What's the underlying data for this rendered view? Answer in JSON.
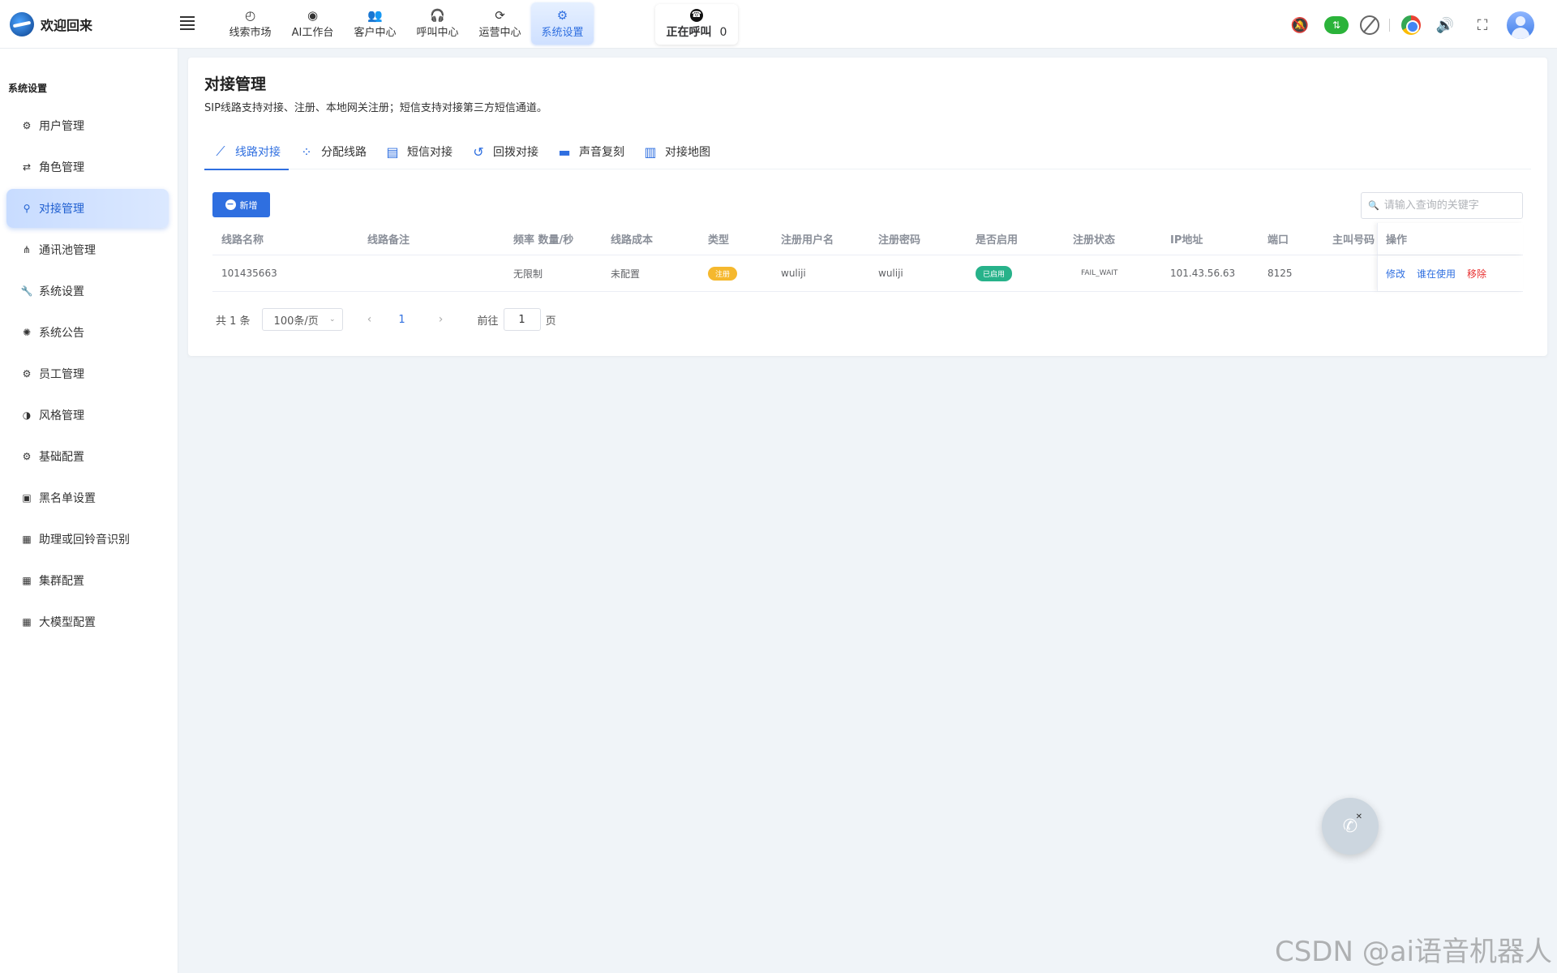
{
  "header": {
    "brand_title": "欢迎回来",
    "nav": [
      {
        "label": "线索市场",
        "icon": "clock-icon",
        "glyph": "◴"
      },
      {
        "label": "AI工作台",
        "icon": "robot-icon",
        "glyph": "◉"
      },
      {
        "label": "客户中心",
        "icon": "users-icon",
        "glyph": "👥"
      },
      {
        "label": "呼叫中心",
        "icon": "headset-icon",
        "glyph": "🎧"
      },
      {
        "label": "运营中心",
        "icon": "cycle-icon",
        "glyph": "⟳"
      },
      {
        "label": "系统设置",
        "icon": "gear-icon",
        "glyph": "⚙"
      }
    ],
    "calling_label": "正在呼叫",
    "calling_count": "0"
  },
  "sidebar": {
    "section_title": "系统设置",
    "items": [
      {
        "label": "用户管理",
        "glyph": "⚙"
      },
      {
        "label": "角色管理",
        "glyph": "⇄"
      },
      {
        "label": "对接管理",
        "glyph": "⚲"
      },
      {
        "label": "通讯池管理",
        "glyph": "⋔"
      },
      {
        "label": "系统设置",
        "glyph": "🔧"
      },
      {
        "label": "系统公告",
        "glyph": "✺"
      },
      {
        "label": "员工管理",
        "glyph": "⚙"
      },
      {
        "label": "风格管理",
        "glyph": "◑"
      },
      {
        "label": "基础配置",
        "glyph": "⚙"
      },
      {
        "label": "黑名单设置",
        "glyph": "▣"
      },
      {
        "label": "助理或回铃音识别",
        "glyph": "▦"
      },
      {
        "label": "集群配置",
        "glyph": "▦"
      },
      {
        "label": "大模型配置",
        "glyph": "▦"
      }
    ]
  },
  "page": {
    "title": "对接管理",
    "description": "SIP线路支持对接、注册、本地网关注册；短信支持对接第三方短信通道。",
    "tabs": [
      {
        "label": "线路对接",
        "glyph": "⟋"
      },
      {
        "label": "分配线路",
        "glyph": "⁘"
      },
      {
        "label": "短信对接",
        "glyph": "▤"
      },
      {
        "label": "回拨对接",
        "glyph": "↺"
      },
      {
        "label": "声音复刻",
        "glyph": "▬"
      },
      {
        "label": "对接地图",
        "glyph": "▥"
      }
    ],
    "add_button": "新增",
    "search_placeholder": "请输入查询的关键字"
  },
  "table": {
    "columns": [
      "线路名称",
      "线路备注",
      "频率 数量/秒",
      "线路成本",
      "类型",
      "注册用户名",
      "注册密码",
      "是否启用",
      "注册状态",
      "IP地址",
      "端口",
      "主叫号码",
      "操作"
    ],
    "rows": [
      {
        "name": "101435663",
        "remark": "",
        "frequency": "无限制",
        "cost": "未配置",
        "type": "注册",
        "username": "wuliji",
        "password": "wuliji",
        "enabled": "已启用",
        "status": "FAIL_WAIT",
        "ip": "101.43.56.63",
        "port": "8125",
        "caller": "",
        "actions": [
          "修改",
          "谁在使用",
          "移除"
        ]
      }
    ]
  },
  "pagination": {
    "total": "共 1 条",
    "page_size": "100条/页",
    "prev": "‹",
    "current": "1",
    "next": "›",
    "goto_label": "前往",
    "goto_value": "1",
    "page_unit": "页"
  },
  "watermark": "CSDN @ai语音机器人",
  "colors": {
    "accent": "#2f6fe0",
    "danger": "#e83030",
    "warning": "#f5b82e",
    "success": "#27b28a"
  }
}
